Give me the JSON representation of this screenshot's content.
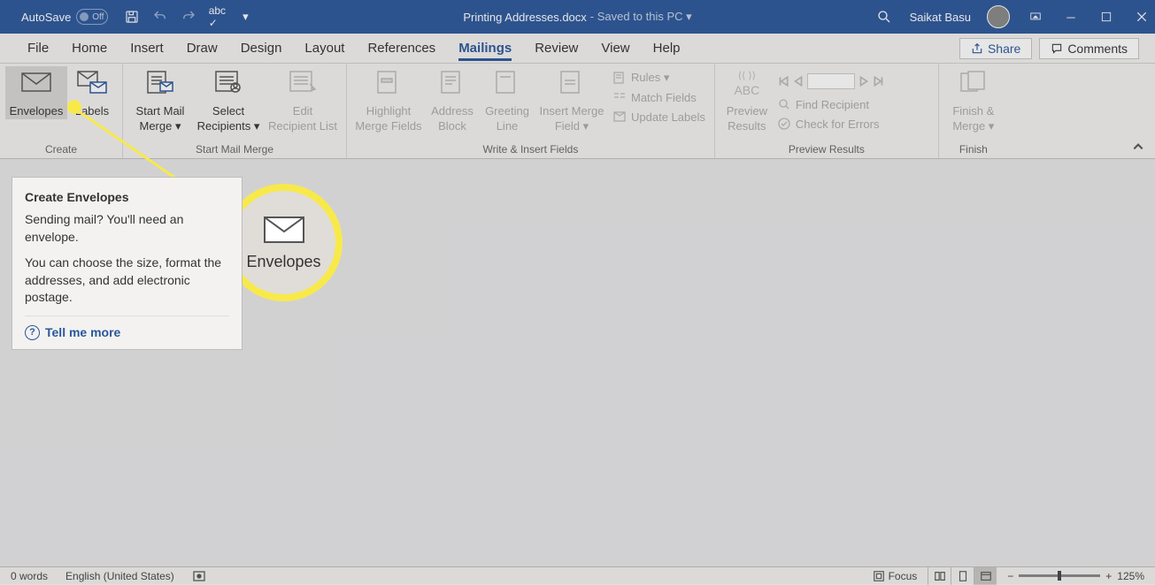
{
  "titlebar": {
    "autosave_label": "AutoSave",
    "autosave_state": "Off",
    "filename": "Printing Addresses.docx",
    "saved_status": "- Saved to this PC ▾",
    "username": "Saikat Basu"
  },
  "tabs": [
    "File",
    "Home",
    "Insert",
    "Draw",
    "Design",
    "Layout",
    "References",
    "Mailings",
    "Review",
    "View",
    "Help"
  ],
  "active_tab": "Mailings",
  "share_btn": "Share",
  "comments_btn": "Comments",
  "ribbon": {
    "create": {
      "label": "Create",
      "envelopes": "Envelopes",
      "labels": "Labels"
    },
    "start": {
      "label": "Start Mail Merge",
      "start_mm": "Start Mail\nMerge ▾",
      "select_rec": "Select\nRecipients ▾",
      "edit_rec": "Edit\nRecipient List"
    },
    "write": {
      "label": "Write & Insert Fields",
      "highlight": "Highlight\nMerge Fields",
      "address": "Address\nBlock",
      "greeting": "Greeting\nLine",
      "insert_mf": "Insert Merge\nField ▾",
      "rules": "Rules ▾",
      "match": "Match Fields",
      "update": "Update Labels"
    },
    "preview": {
      "label": "Preview Results",
      "preview": "Preview\nResults",
      "find": "Find Recipient",
      "check": "Check for Errors"
    },
    "finish": {
      "label": "Finish",
      "finish": "Finish &\nMerge ▾"
    }
  },
  "tooltip": {
    "title": "Create Envelopes",
    "p1": "Sending mail? You'll need an envelope.",
    "p2": "You can choose the size, format the addresses, and add electronic postage.",
    "tellmore": "Tell me more"
  },
  "callout_label": "Envelopes",
  "statusbar": {
    "words": "0 words",
    "lang": "English (United States)",
    "focus": "Focus",
    "zoom": "125%"
  }
}
